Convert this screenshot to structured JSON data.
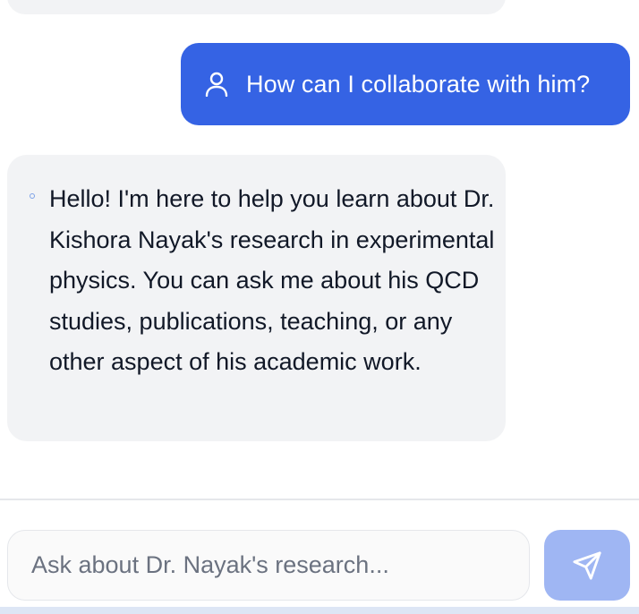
{
  "conversation": {
    "user_message": "How can I collaborate with him?",
    "assistant_message": "Hello! I'm here to help you learn about Dr. Kishora Nayak's research in experimental physics. You can ask me about his QCD studies, publications, teaching, or any other aspect of his academic work."
  },
  "composer": {
    "placeholder": "Ask about Dr. Nayak's research...",
    "value": ""
  },
  "icons": {
    "user": "user-icon",
    "bot": "bot-icon",
    "send": "send-icon"
  },
  "colors": {
    "user_bubble": "#3563e4",
    "assistant_bubble": "#f2f3f5",
    "send_button": "#9fb6f3"
  }
}
